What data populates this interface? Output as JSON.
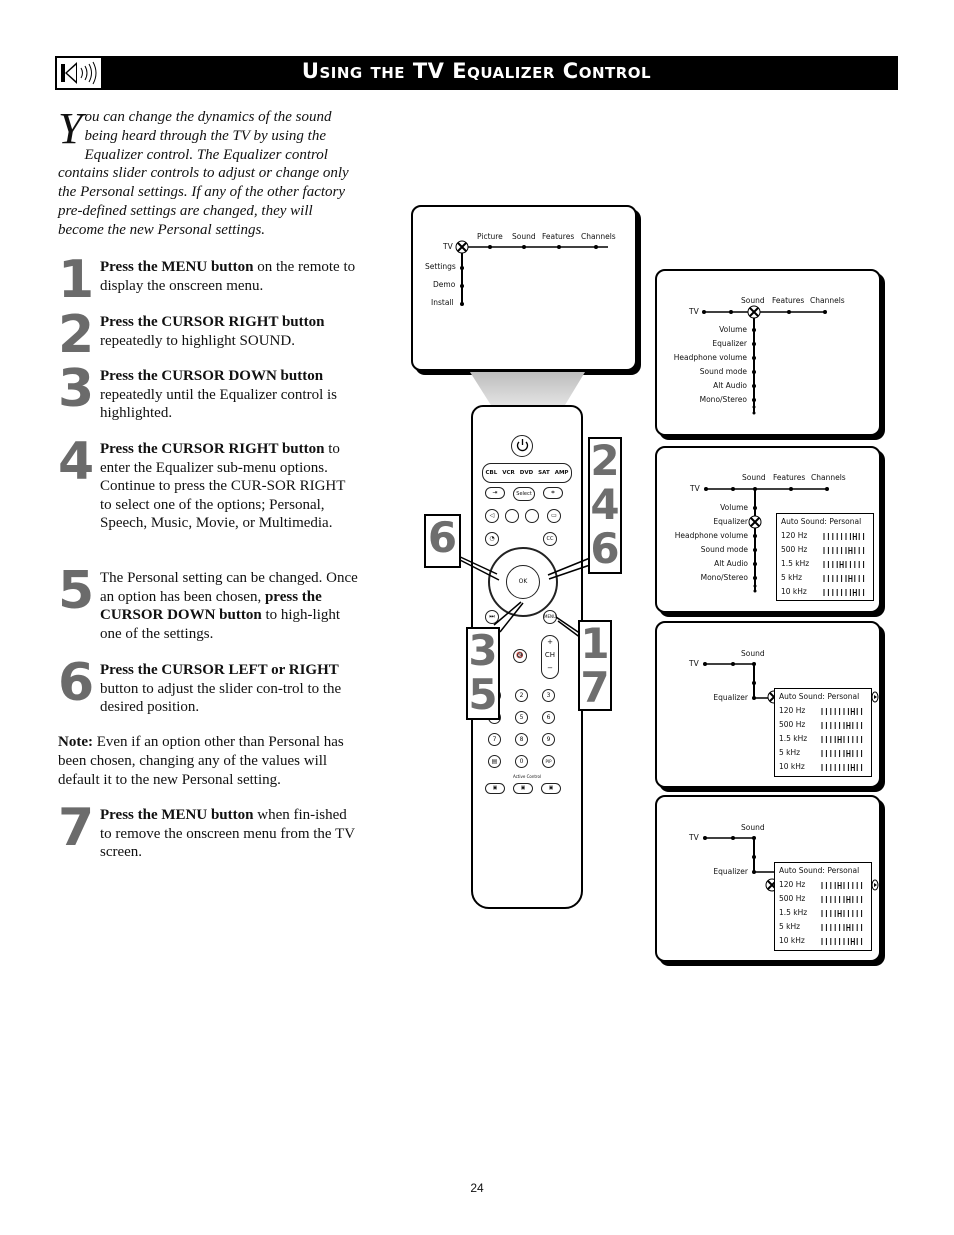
{
  "header": {
    "title": "Using the TV Equalizer Control",
    "icon": "speaker-sound-icon"
  },
  "intro": {
    "dropcap": "Y",
    "text": "ou can change the dynamics of the sound being heard through the TV by using the Equalizer control.  The Equalizer control contains slider controls to adjust or change only the Personal settings. If any of the other factory pre-defined settings are changed, they will become the new Personal settings."
  },
  "steps": [
    {
      "num": "1",
      "bold": "Press the MENU button",
      "text": " on the remote to display the onscreen menu."
    },
    {
      "num": "2",
      "bold": "Press the CURSOR RIGHT button",
      "text": " repeatedly to highlight SOUND."
    },
    {
      "num": "3",
      "bold": "Press the CURSOR DOWN button",
      "text": " repeatedly until the Equalizer control is highlighted."
    },
    {
      "num": "4",
      "bold": "Press the CURSOR RIGHT button",
      "text": " to enter the Equalizer sub-menu options. Continue to press the CUR-SOR RIGHT to select one of the options; Personal, Speech, Music, Movie, or Multimedia."
    },
    {
      "num": "5",
      "pre": "The Personal setting can be changed. Once an option has been chosen, ",
      "bold": "press the CURSOR DOWN button",
      "text": " to high-light one of the settings."
    },
    {
      "num": "6",
      "bold": "Press the CURSOR LEFT or RIGHT",
      "text": " button to adjust the slider con-trol to the desired position."
    },
    {
      "num": "7",
      "bold": "Press the MENU button",
      "text": " when fin-ished to remove the onscreen menu from the TV screen."
    }
  ],
  "note": {
    "label": "Note:",
    "text": " Even if an option other than Personal has been chosen, changing any of the values will default it to the new Personal setting."
  },
  "screens": {
    "main_menu": {
      "root": "TV",
      "top_items": [
        "Picture",
        "Sound",
        "Features",
        "Channels"
      ],
      "side_items": [
        "Settings",
        "Demo",
        "Install"
      ]
    },
    "sound_menu": {
      "root": "TV",
      "top_items": [
        "Sound",
        "Features",
        "Channels"
      ],
      "side_items": [
        "Volume",
        "Equalizer",
        "Headphone volume",
        "Sound mode",
        "Alt Audio",
        "Mono/Stereo"
      ]
    },
    "equalizer": {
      "header": "Auto  Sound:  Personal",
      "bands": [
        "120  Hz",
        "500  Hz",
        "1.5  kHz",
        "5  kHz",
        "10  kHz"
      ],
      "sound_label": "Sound",
      "equalizer_label": "Equalizer",
      "tv_label": "TV",
      "screen3_positions": [
        7,
        6,
        4,
        6,
        7
      ],
      "screen4_positions": [
        7,
        6,
        4,
        6,
        7
      ],
      "screen5_positions": [
        4,
        6,
        4,
        6,
        7
      ]
    }
  },
  "remote": {
    "source_buttons": [
      "CBL",
      "VCR",
      "DVD",
      "SAT",
      "AMP"
    ],
    "select_label": "Select",
    "ok_label": "OK",
    "menu_label": "MENU",
    "ch_label": "CH",
    "cc_label": "CC",
    "pip_label": "PIP",
    "active_control_label": "Active Control",
    "digits": [
      "1",
      "2",
      "3",
      "4",
      "5",
      "6",
      "7",
      "8",
      "9",
      "0"
    ],
    "callouts": {
      "left": [
        "6"
      ],
      "right_top": [
        "2",
        "4",
        "6"
      ],
      "left_bottom": [
        "3",
        "5"
      ],
      "right_bottom": [
        "1",
        "7"
      ]
    }
  },
  "page_number": "24"
}
